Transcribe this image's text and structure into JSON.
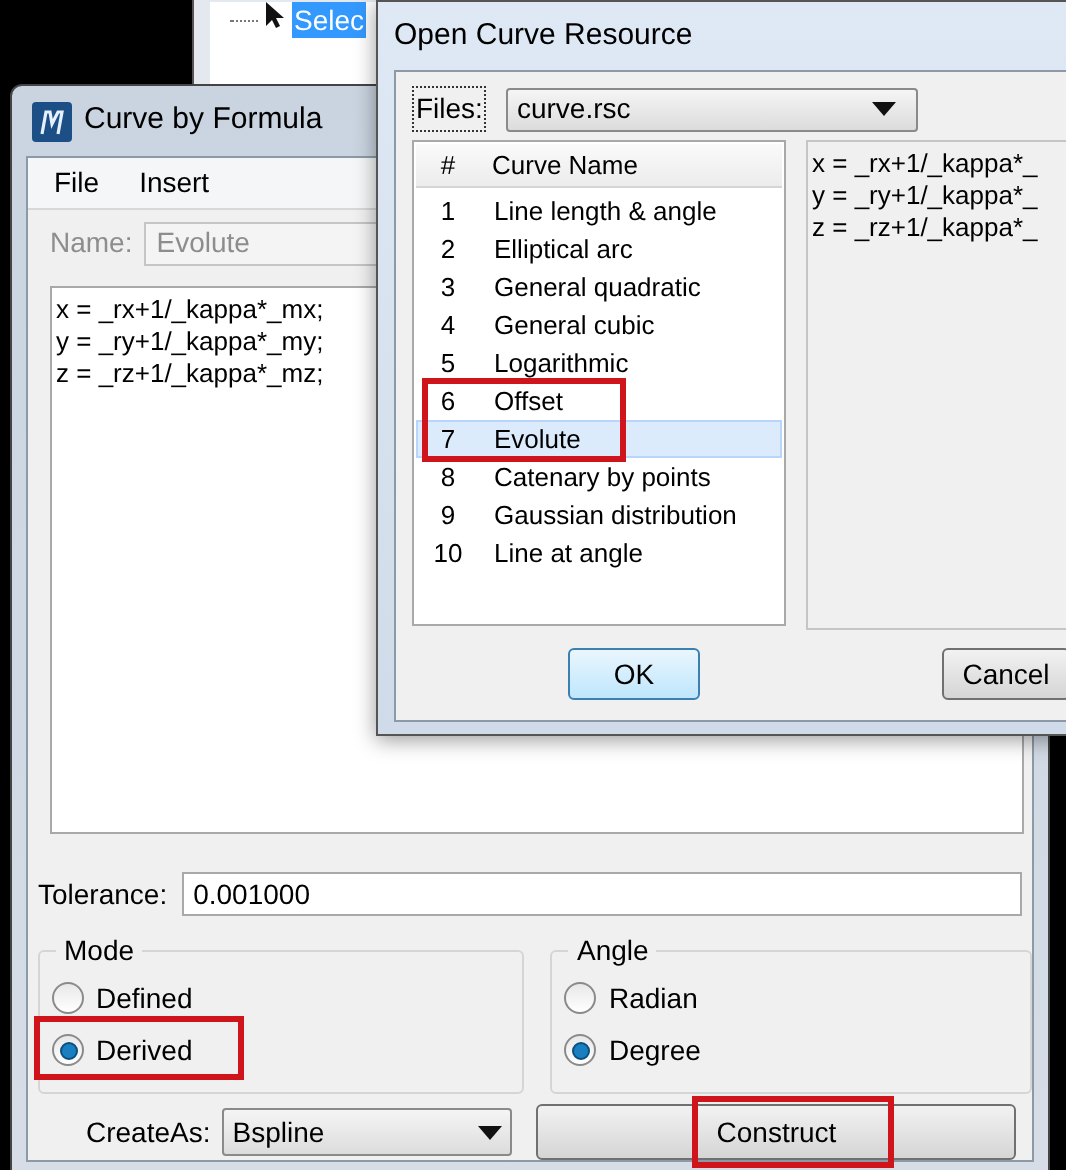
{
  "background_window": {
    "tree_item": "Selec"
  },
  "formula_window": {
    "title": "Curve by Formula",
    "menu": [
      "File",
      "Insert"
    ],
    "name_label": "Name:",
    "name_value": "Evolute",
    "name_disabled": true,
    "formula_lines": [
      "x = _rx+1/_kappa*_mx;",
      "y = _ry+1/_kappa*_my;",
      "z = _rz+1/_kappa*_mz;"
    ],
    "tolerance_label": "Tolerance:",
    "tolerance": "0.001000",
    "mode": {
      "title": "Mode",
      "options": [
        {
          "label": "Defined",
          "selected": false,
          "marked": false
        },
        {
          "label": "Derived",
          "selected": true,
          "marked": true
        }
      ]
    },
    "angle": {
      "title": "Angle",
      "options": [
        {
          "label": "Radian",
          "selected": false,
          "marked": false
        },
        {
          "label": "Degree",
          "selected": true,
          "marked": false
        }
      ]
    },
    "create_as_label": "CreateAs:",
    "create_as": "Bspline",
    "construct": {
      "label": "Construct",
      "marked": true
    }
  },
  "dialog": {
    "title": "Open Curve Resource",
    "files_label": "Files:",
    "files": "curve.rsc",
    "columns": [
      "#",
      "Curve Name"
    ],
    "curves": [
      {
        "number": "1",
        "name": "Line length & angle",
        "selected": false,
        "marked": false
      },
      {
        "number": "2",
        "name": "Elliptical arc",
        "selected": false,
        "marked": false
      },
      {
        "number": "3",
        "name": "General quadratic",
        "selected": false,
        "marked": false
      },
      {
        "number": "4",
        "name": "General cubic",
        "selected": false,
        "marked": false
      },
      {
        "number": "5",
        "name": "Logarithmic",
        "selected": false,
        "marked": false
      },
      {
        "number": "6",
        "name": "Offset",
        "selected": false,
        "marked": true
      },
      {
        "number": "7",
        "name": "Evolute",
        "selected": true,
        "marked": true
      },
      {
        "number": "8",
        "name": "Catenary by points",
        "selected": false,
        "marked": false
      },
      {
        "number": "9",
        "name": "Gaussian distribution",
        "selected": false,
        "marked": false
      },
      {
        "number": "10",
        "name": "Line at angle",
        "selected": false,
        "marked": false
      }
    ],
    "preview_lines": [
      "x = _rx+1/_kappa*_",
      "y = _ry+1/_kappa*_",
      "z = _rz+1/_kappa*_"
    ],
    "ok": "OK",
    "cancel": "Cancel"
  }
}
